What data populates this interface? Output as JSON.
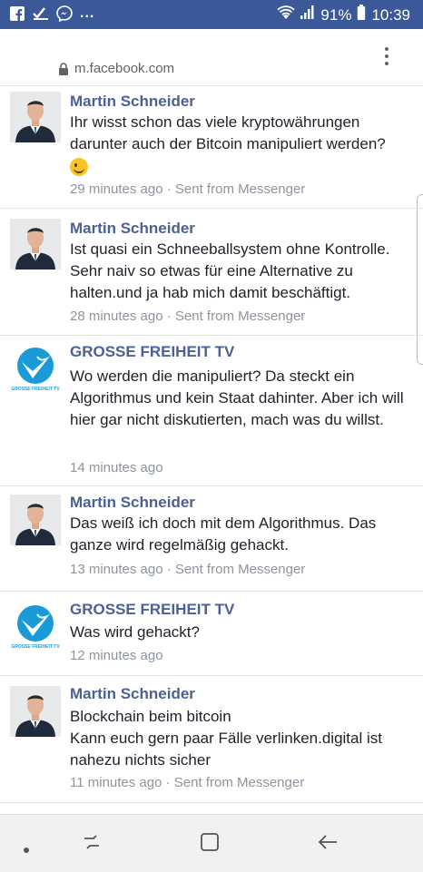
{
  "status_bar": {
    "battery": "91%",
    "time": "10:39",
    "more_indicator": "..."
  },
  "browser": {
    "url": "m.facebook.com"
  },
  "comments": [
    {
      "author": "Martin Schneider",
      "avatar": "man-in-suit-photo",
      "text": "Ihr wisst schon das viele kryptowährungen darunter auch der Bitcoin manipuliert werden?",
      "emoji": "winking-face-emoji",
      "time": "29 minutes ago",
      "source": "· Sent from Messenger"
    },
    {
      "author": "Martin Schneider",
      "avatar": "man-in-suit-photo",
      "text": "Ist quasi ein Schneeballsystem ohne Kontrolle. Sehr naiv so etwas für eine Alternative zu halten.und ja hab mich damit beschäftigt.",
      "time": "28 minutes ago",
      "source": "· Sent from Messenger"
    },
    {
      "author": "GROSSE FREIHEIT TV",
      "avatar": "grosse-freiheit-logo",
      "logo_text": "GROSSE FREIHEIT TV",
      "text": "Wo werden die manipuliert? Da steckt ein Algorithmus und kein Staat dahinter. Aber ich will hier gar nicht diskutierten, mach was du willst.",
      "time": "14 minutes ago"
    },
    {
      "author": "Martin Schneider",
      "avatar": "man-in-suit-photo",
      "text": "Das weiß ich doch mit dem Algorithmus. Das ganze wird regelmäßig gehackt.",
      "time": "13 minutes ago",
      "source": "· Sent from Messenger"
    },
    {
      "author": "GROSSE FREIHEIT TV",
      "avatar": "grosse-freiheit-logo",
      "logo_text": "GROSSE FREIHEIT TV",
      "text": "Was wird gehackt?",
      "time": "12 minutes ago"
    },
    {
      "author": "Martin Schneider",
      "avatar": "man-in-suit-photo",
      "text_lines": [
        "Blockchain beim bitcoin",
        "Kann euch gern paar Fälle verlinken.digital ist nahezu nichts sicher"
      ],
      "time": "11 minutes ago",
      "source": "· Sent from Messenger"
    }
  ],
  "colors": {
    "status_bar": "#3b5998",
    "author_name": "#4b6094",
    "meta_text": "#8d949e",
    "logo_blue": "#1a9bd7"
  },
  "nav_icons": [
    "dot-icon",
    "recent-apps-icon",
    "home-icon",
    "back-icon"
  ]
}
